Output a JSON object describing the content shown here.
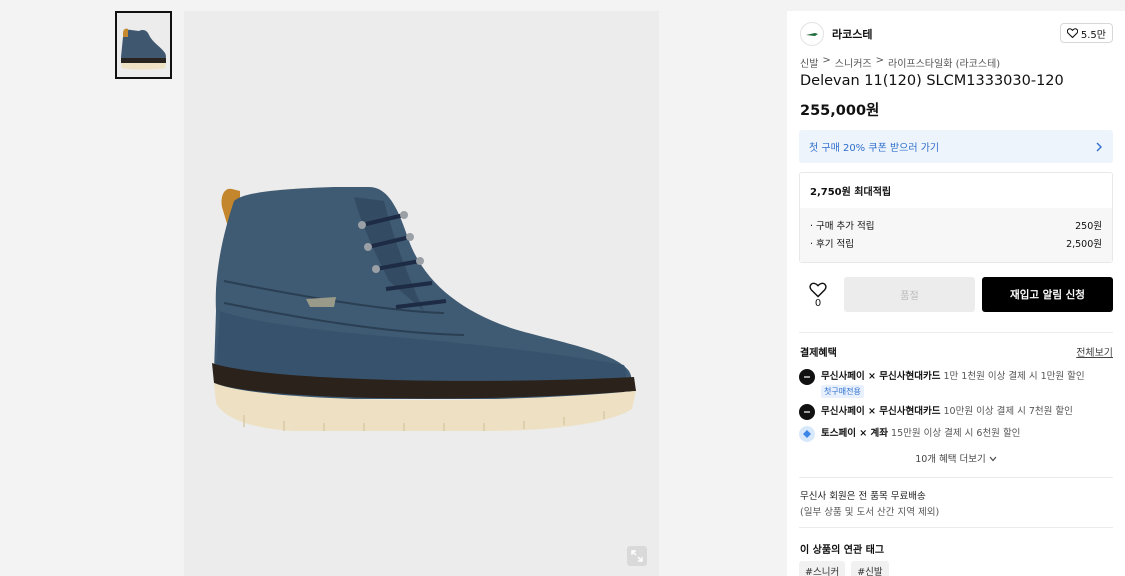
{
  "gallery": {
    "thumbnail_icon": "shoe-thumbnail",
    "main_image_icon": "navy-leather-chukka-boot",
    "zoom_icon": "expand-icon"
  },
  "brand": {
    "name": "라코스테",
    "logo_icon": "crocodile-logo",
    "likes": "5.5만"
  },
  "breadcrumb": [
    "신발",
    ">",
    "스니커즈",
    ">",
    "라이프스타일화 (라코스테)"
  ],
  "product": {
    "name": "Delevan 11(120) SLCM1333030-120",
    "price": "255,000원"
  },
  "coupon": {
    "label": "첫 구매 20% 쿠폰 받으러 가기",
    "accent_color": "#2f6fce"
  },
  "points": {
    "title": "2,750원 최대적립",
    "rows": [
      {
        "label": "· 구매 추가 적립",
        "value": "250원"
      },
      {
        "label": "· 후기 적립",
        "value": "2,500원"
      }
    ]
  },
  "actions": {
    "wish_count": "0",
    "soldout_label": "품절",
    "restock_label": "재입고 알림 신청"
  },
  "benefits": {
    "title": "결제혜택",
    "more_link": "전체보기",
    "items": [
      {
        "brand": "무신사페이 × 무신사현대카드",
        "desc": "1만 1천원 이상 결제 시 1만원 할인",
        "badge": "첫구매전용",
        "icon": "musinsa-pay-icon"
      },
      {
        "brand": "무신사페이 × 무신사현대카드",
        "desc": "10만원 이상 결제 시 7천원 할인",
        "icon": "musinsa-pay-icon"
      },
      {
        "brand": "토스페이 × 계좌",
        "desc": "15만원 이상 결제 시 6천원 할인",
        "icon": "toss-pay-icon"
      }
    ],
    "expand_label": "10개 혜택 더보기"
  },
  "shipping": {
    "line1": "무신사 회원은 전 품목 무료배송",
    "line2": "(일부 상품 및 도서 산간 지역 제외)"
  },
  "tags": {
    "title": "이 상품의 연관 태그",
    "items": [
      "#스니커",
      "#신발"
    ]
  }
}
